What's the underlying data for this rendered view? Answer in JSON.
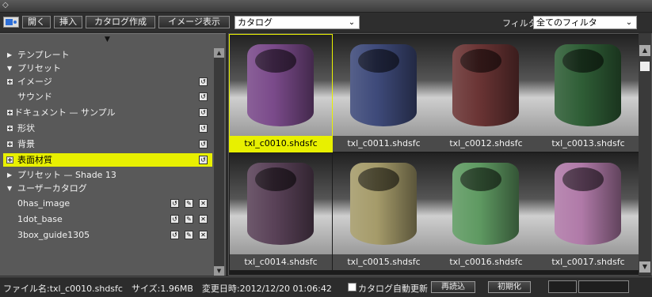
{
  "toolbar": {
    "open_label": "開く",
    "insert_label": "挿入",
    "create_catalog_label": "カタログ作成",
    "image_view_label": "イメージ表示",
    "catalog_select_value": "カタログ",
    "filter_label": "フィルタ",
    "filter_select_value": "全てのフィルタ"
  },
  "tree": {
    "items": [
      {
        "label": "テンプレート"
      },
      {
        "label": "プリセット"
      },
      {
        "label": "イメージ"
      },
      {
        "label": "サウンド"
      },
      {
        "label": "ドキュメント — サンプル"
      },
      {
        "label": "形状"
      },
      {
        "label": "背景"
      },
      {
        "label": "表面材質"
      },
      {
        "label": "プリセット — Shade 13"
      },
      {
        "label": "ユーザーカタログ"
      },
      {
        "label": "0has_image"
      },
      {
        "label": "1dot_base"
      },
      {
        "label": "3box_guide1305"
      }
    ]
  },
  "thumbnails": [
    {
      "name": "txl_c0010.shdsfc",
      "color": "#7a4a8a"
    },
    {
      "name": "txl_c0011.shdsfc",
      "color": "#3e4a7a"
    },
    {
      "name": "txl_c0012.shdsfc",
      "color": "#6a3434"
    },
    {
      "name": "txl_c0013.shdsfc",
      "color": "#2f5e36"
    },
    {
      "name": "txl_c0014.shdsfc",
      "color": "#5a4258"
    },
    {
      "name": "txl_c0015.shdsfc",
      "color": "#a59b6a"
    },
    {
      "name": "txl_c0016.shdsfc",
      "color": "#5f9a62"
    },
    {
      "name": "txl_c0017.shdsfc",
      "color": "#b07aa8"
    }
  ],
  "status": {
    "text": "ファイル名:txl_c0010.shdsfc　サイズ:1.96MB　変更日時:2012/12/20 01:06:42",
    "auto_update_label": "カタログ自動更新",
    "reload_label": "再読込",
    "init_label": "初期化"
  },
  "colors": {
    "selection": "#e8f000"
  }
}
